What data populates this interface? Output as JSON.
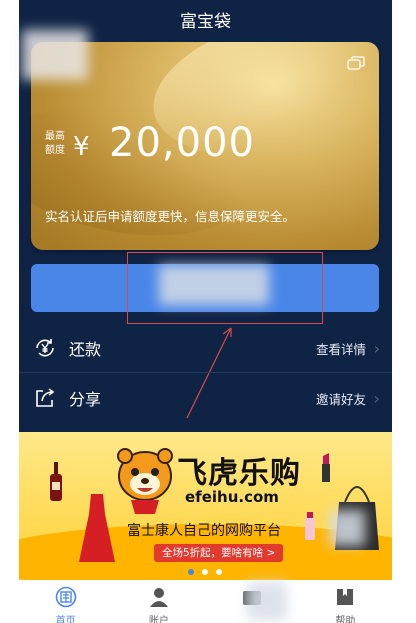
{
  "header": {
    "title": "富宝袋"
  },
  "card": {
    "limit_label": "最高额度",
    "currency": "¥",
    "amount": "20,000",
    "note": "实名认证后申请额度更快，信息保障更安全。"
  },
  "main_button": {
    "label": ""
  },
  "rows": [
    {
      "label": "还款",
      "action": "查看详情",
      "icon": "repay-icon"
    },
    {
      "label": "分享",
      "action": "邀请好友",
      "icon": "share-icon"
    }
  ],
  "banner": {
    "brand_cn": "飞虎乐购",
    "brand_en": "efeihu.com",
    "slogan": "富士康人自己的网购平台",
    "promo": "全场5折起，要啥有啥 >"
  },
  "tabs": [
    {
      "label": "首页",
      "icon": "home-icon",
      "active": true
    },
    {
      "label": "账户",
      "icon": "user-icon",
      "active": false
    },
    {
      "label": "",
      "icon": "wallet-icon",
      "active": false
    },
    {
      "label": "帮助",
      "icon": "help-book-icon",
      "active": false
    }
  ],
  "colors": {
    "background": "#0f2345",
    "accent": "#4a86e8",
    "card_gold": "#c9a24a"
  }
}
